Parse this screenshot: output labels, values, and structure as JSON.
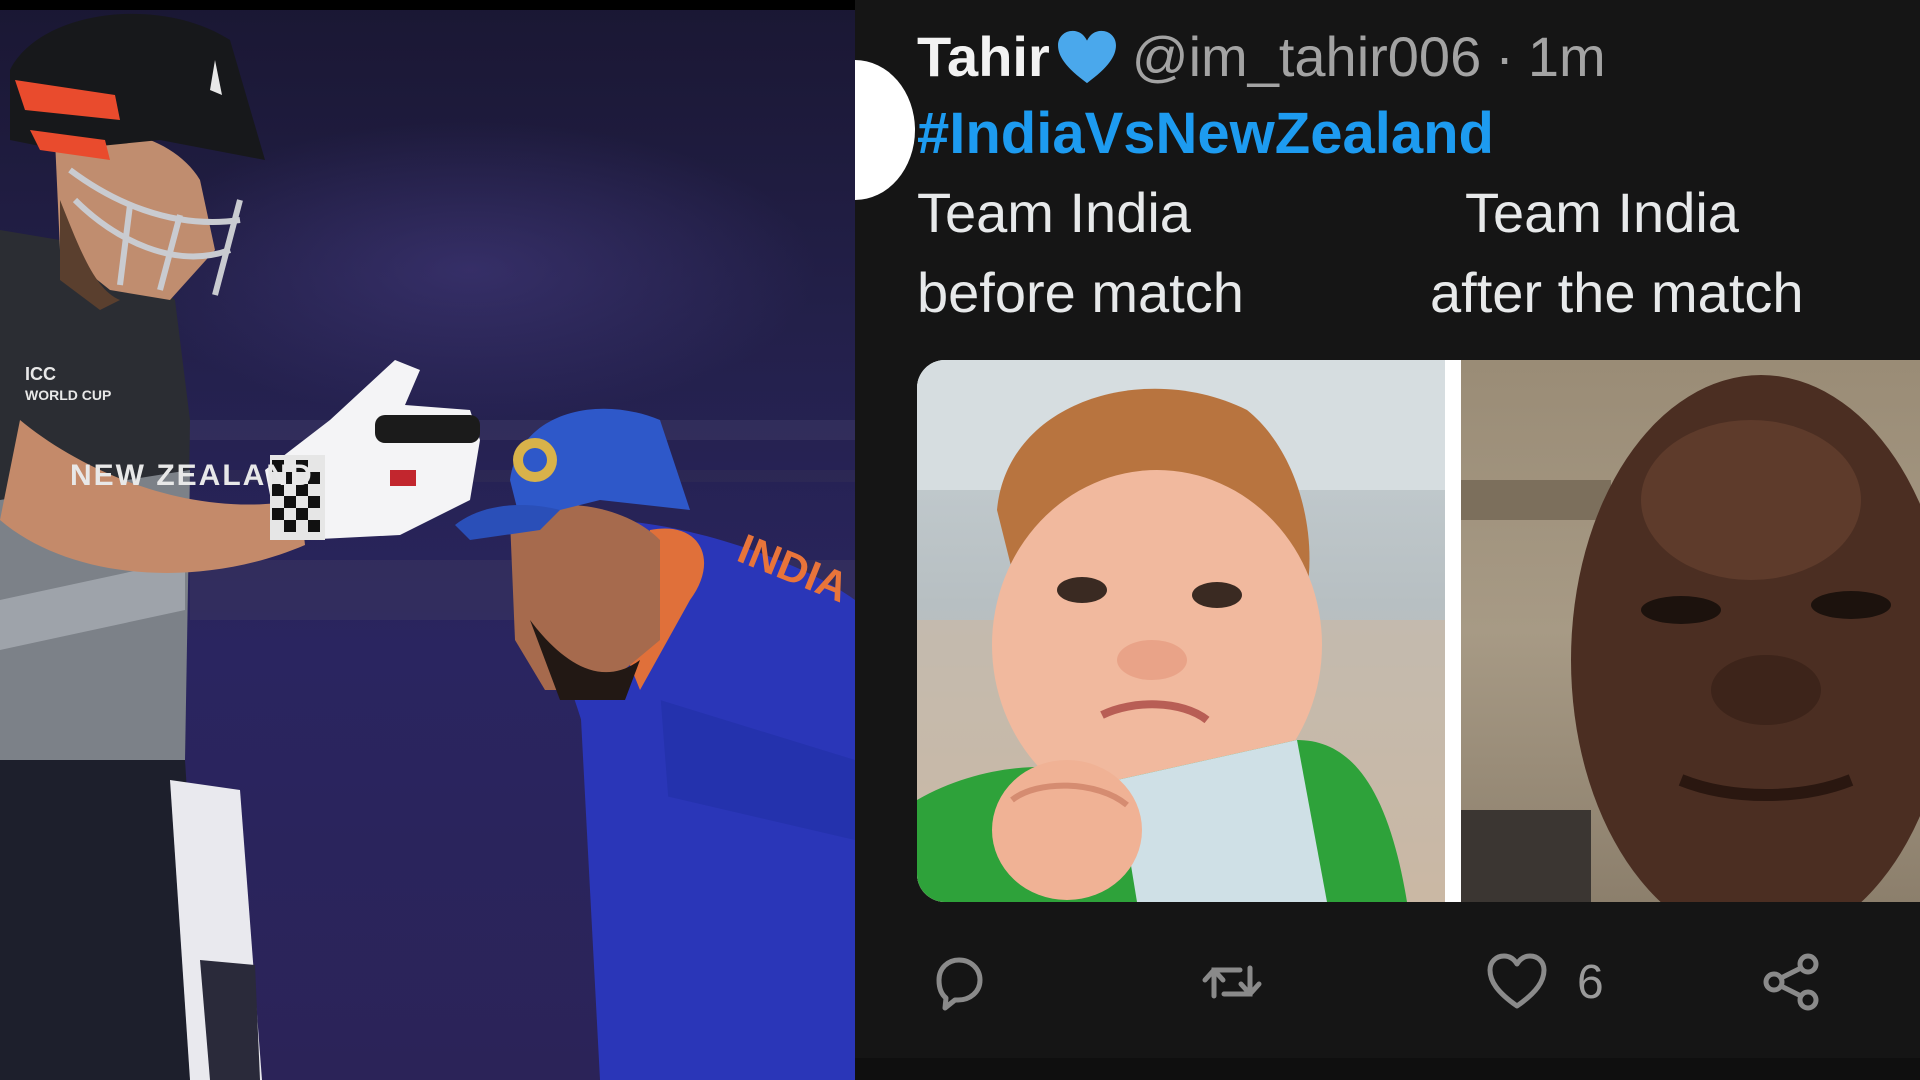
{
  "tweet": {
    "display_name": "Tahir",
    "handle": "@im_tahir006",
    "separator": "·",
    "time": "1m",
    "hashtag": "#IndiaVsNewZealand",
    "caption_left_line1": "Team India",
    "caption_left_line2": "before match",
    "caption_right_line1": "Team India",
    "caption_right_line2": "after the match",
    "like_count": "6"
  },
  "photo": {
    "helmet_label": "NEW ZEALAND",
    "jersey_text": "INDIA"
  },
  "colors": {
    "hashtag_blue": "#1d9bf0",
    "heart_badge_blue": "#4aa8ec",
    "tweet_background": "#151515",
    "action_icon_gray": "#8a8a8a"
  },
  "icons": [
    "blue-heart-icon",
    "reply-icon",
    "retweet-icon",
    "like-icon",
    "share-icon"
  ]
}
